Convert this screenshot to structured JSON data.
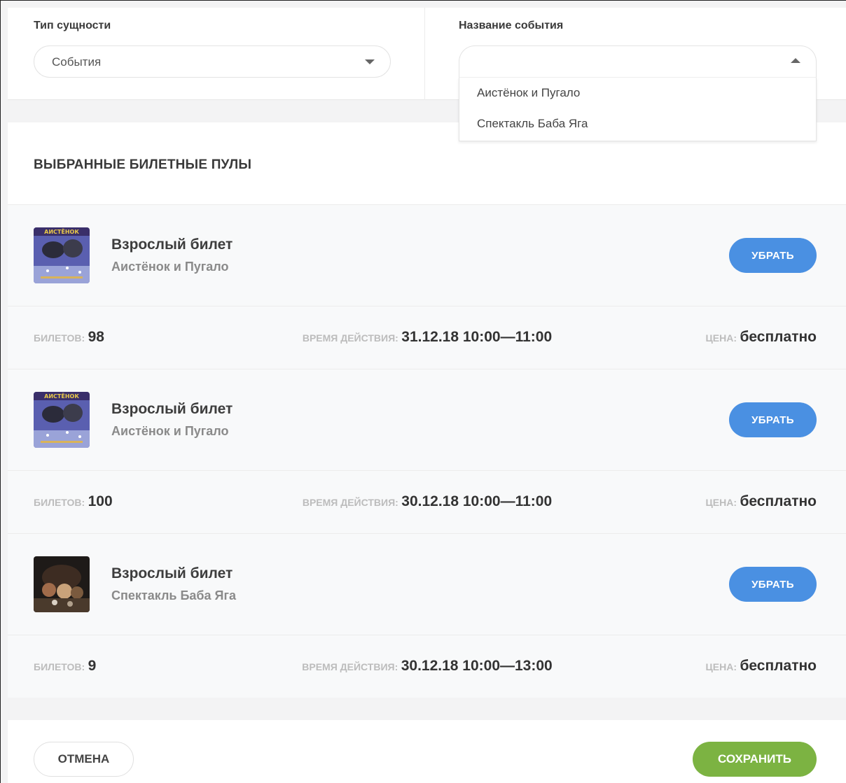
{
  "filters": {
    "entity_type": {
      "label": "Тип сущности",
      "value": "События"
    },
    "event_name": {
      "label": "Название события",
      "value": "",
      "options": [
        "Аистёнок и Пугало",
        "Спектакль Баба Яга"
      ]
    }
  },
  "section_title": "ВЫБРАННЫЕ БИЛЕТНЫЕ ПУЛЫ",
  "labels": {
    "tickets": "БИЛЕТОВ:",
    "validity": "ВРЕМЯ ДЕЙСТВИЯ:",
    "price": "ЦЕНА:",
    "remove": "УБРАТЬ"
  },
  "pools": [
    {
      "name": "Взрослый билет",
      "event": "Аистёнок и Пугало",
      "tickets": "98",
      "validity": "31.12.18 10:00—11:00",
      "price": "бесплатно",
      "thumb_icon": "stork-poster-icon"
    },
    {
      "name": "Взрослый билет",
      "event": "Аистёнок и Пугало",
      "tickets": "100",
      "validity": "30.12.18 10:00—11:00",
      "price": "бесплатно",
      "thumb_icon": "stork-poster-icon"
    },
    {
      "name": "Взрослый билет",
      "event": "Спектакль Баба Яга",
      "tickets": "9",
      "validity": "30.12.18 10:00—13:00",
      "price": "бесплатно",
      "thumb_icon": "baba-yaga-poster-icon"
    }
  ],
  "footer": {
    "cancel": "ОТМЕНА",
    "save": "СОХРАНИТЬ"
  },
  "colors": {
    "primary": "#4a90e2",
    "success": "#7cb342"
  }
}
